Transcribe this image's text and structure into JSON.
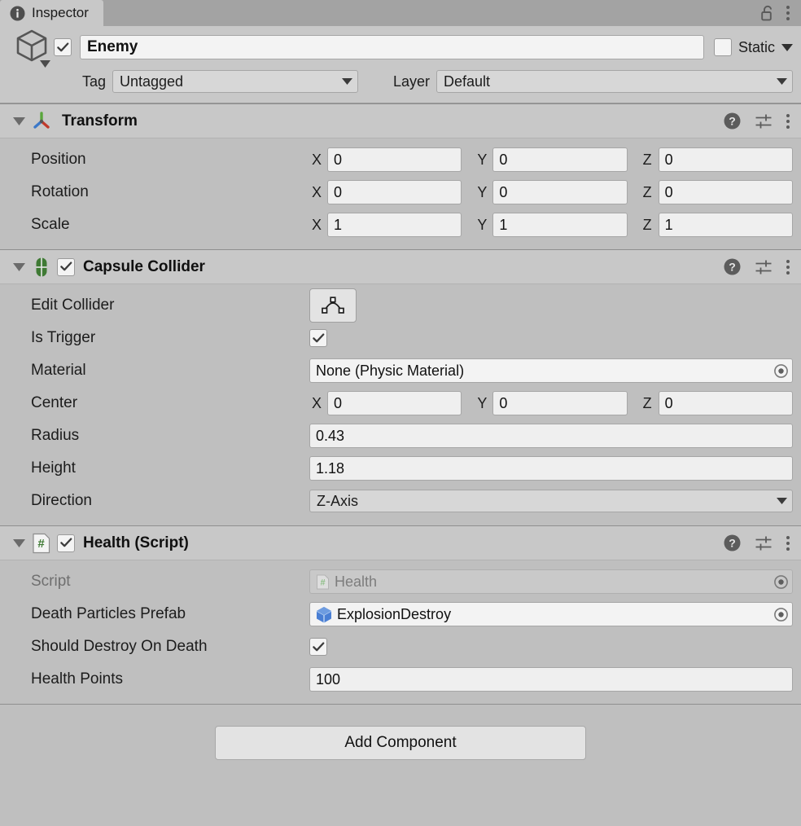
{
  "window": {
    "tab_label": "Inspector",
    "tab_icon": "info-icon",
    "lock_icon": "unlocked-padlock-icon",
    "menu_icon": "kebab-menu-icon"
  },
  "gameobject": {
    "icon": "gameobject-cube-icon",
    "enabled": true,
    "name": "Enemy",
    "static_label": "Static",
    "static_checked": false,
    "tag_label": "Tag",
    "tag_value": "Untagged",
    "layer_label": "Layer",
    "layer_value": "Default"
  },
  "components": [
    {
      "title": "Transform",
      "icon": "transform-axis-gizmo-icon",
      "has_enable_checkbox": false,
      "expanded": true,
      "rows": [
        {
          "type": "vector3",
          "label": "Position",
          "axes": [
            "X",
            "Y",
            "Z"
          ],
          "values": [
            "0",
            "0",
            "0"
          ]
        },
        {
          "type": "vector3",
          "label": "Rotation",
          "axes": [
            "X",
            "Y",
            "Z"
          ],
          "values": [
            "0",
            "0",
            "0"
          ]
        },
        {
          "type": "vector3",
          "label": "Scale",
          "axes": [
            "X",
            "Y",
            "Z"
          ],
          "values": [
            "1",
            "1",
            "1"
          ]
        }
      ]
    },
    {
      "title": "Capsule Collider",
      "icon": "capsule-collider-icon",
      "has_enable_checkbox": true,
      "enabled": true,
      "expanded": true,
      "rows": [
        {
          "type": "button",
          "label": "Edit Collider",
          "button_icon": "polygon-edit-icon"
        },
        {
          "type": "checkbox",
          "label": "Is Trigger",
          "checked": true
        },
        {
          "type": "object",
          "label": "Material",
          "value": "None (Physic Material)",
          "value_icon": null,
          "disabled": false
        },
        {
          "type": "vector3",
          "label": "Center",
          "axes": [
            "X",
            "Y",
            "Z"
          ],
          "values": [
            "0",
            "0",
            "0"
          ]
        },
        {
          "type": "number",
          "label": "Radius",
          "value": "0.43"
        },
        {
          "type": "number",
          "label": "Height",
          "value": "1.18"
        },
        {
          "type": "dropdown",
          "label": "Direction",
          "value": "Z-Axis"
        }
      ]
    },
    {
      "title": "Health (Script)",
      "icon": "csharp-script-icon",
      "has_enable_checkbox": true,
      "enabled": true,
      "expanded": true,
      "rows": [
        {
          "type": "object",
          "label": "Script",
          "value": "Health",
          "value_icon": "csharp-script-icon",
          "disabled": true
        },
        {
          "type": "object",
          "label": "Death Particles Prefab",
          "value": "ExplosionDestroy",
          "value_icon": "prefab-cube-icon",
          "disabled": false
        },
        {
          "type": "checkbox",
          "label": "Should Destroy On Death",
          "checked": true
        },
        {
          "type": "number",
          "label": "Health Points",
          "value": "100"
        }
      ]
    }
  ],
  "footer": {
    "add_component_label": "Add Component"
  },
  "colors": {
    "panel_bg": "#bfbfbf",
    "header_bg": "#c8c8c8",
    "tabbar_bg": "#a3a3a3",
    "field_bg": "#efefef",
    "collider_green": "#3f7a34",
    "prefab_blue": "#3a6fc4",
    "script_green": "#4a8a3f"
  }
}
